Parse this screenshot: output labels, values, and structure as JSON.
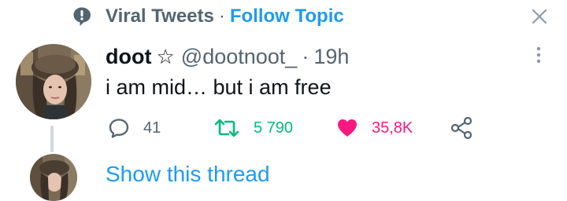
{
  "header": {
    "topic_name": "Viral Tweets",
    "separator": "·",
    "follow_label": "Follow Topic",
    "topic_icon": "speech-bubble-icon",
    "close_icon": "close-icon"
  },
  "tweet": {
    "author_name": "doot",
    "author_badge": "☆",
    "handle": "@dootnoot_",
    "separator": "·",
    "time": "19h",
    "text": "i am mid… but i am free",
    "more_icon": "more-vertical-icon",
    "actions": {
      "reply_count": "41",
      "retweet_count": "5 790",
      "like_count": "35,8K",
      "reply_icon": "reply-icon",
      "retweet_icon": "retweet-icon",
      "like_icon": "heart-icon",
      "share_icon": "share-icon"
    }
  },
  "thread": {
    "show_label": "Show this thread"
  },
  "colors": {
    "text_primary": "#0f1419",
    "text_secondary": "#536471",
    "accent_blue": "#1d9bf0",
    "retweet_green": "#00ba7c",
    "like_pink": "#f91880",
    "thread_line": "#cfd9de"
  }
}
